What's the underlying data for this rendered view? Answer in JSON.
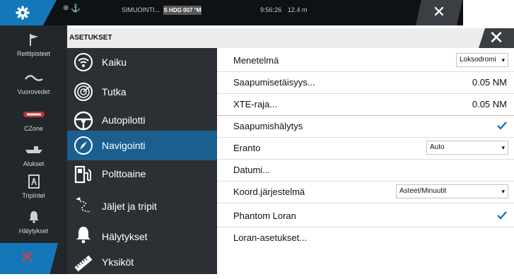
{
  "status_bar": {
    "status_text": "SIMUOINTI...",
    "heading_badge": "S HDG 007 °M",
    "time": "9:56:26",
    "distance": "12.4 m"
  },
  "rail": {
    "items": [
      {
        "label": "Reittipisteet",
        "icon": "flag-icon"
      },
      {
        "label": "Vuorovedet",
        "icon": "tide-wave-icon"
      },
      {
        "label": "CZone",
        "icon": "czone-icon"
      },
      {
        "label": "Alukset",
        "icon": "vessel-icon"
      },
      {
        "label": "TripIntel",
        "icon": "tripintel-icon"
      },
      {
        "label": "Hälytykset",
        "icon": "alarm-bell-icon"
      }
    ]
  },
  "panel": {
    "title": "ASETUKSET"
  },
  "menu": {
    "items": [
      {
        "label": "Kaiku",
        "icon": "sonar-icon"
      },
      {
        "label": "Tutka",
        "icon": "radar-icon"
      },
      {
        "label": "Autopilotti",
        "icon": "steering-wheel-icon"
      },
      {
        "label": "Navigointi",
        "icon": "compass-icon",
        "active": true
      },
      {
        "label": "Polttoaine",
        "icon": "fuel-pump-icon"
      },
      {
        "label": "Jäljet ja tripit",
        "icon": "trail-icon"
      },
      {
        "label": "Hälytykset",
        "icon": "bell-icon"
      },
      {
        "label": "Yksiköt",
        "icon": "ruler-icon"
      }
    ]
  },
  "settings": {
    "method_label": "Menetelmä",
    "method_value": "Loksodromi",
    "arrival_radius_label": "Saapumisetäisyys...",
    "arrival_radius_value": "0.05 NM",
    "xte_label": "XTE-raja...",
    "xte_value": "0.05 NM",
    "arrival_alarm_label": "Saapumishälytys",
    "arrival_alarm_checked": true,
    "variation_label": "Eranto",
    "variation_value": "Auto",
    "datum_label": "Datumi...",
    "coord_label": "Koord.järjestelmä",
    "coord_value": "Asteet/Minuutit",
    "phantom_loran_label": "Phantom Loran",
    "phantom_loran_checked": true,
    "loran_settings_label": "Loran-asetukset..."
  },
  "colors": {
    "accent": "#1478b8",
    "active_menu": "#1b5f8f",
    "alarm_red": "#e53b2f",
    "check_blue": "#1a73b5"
  }
}
